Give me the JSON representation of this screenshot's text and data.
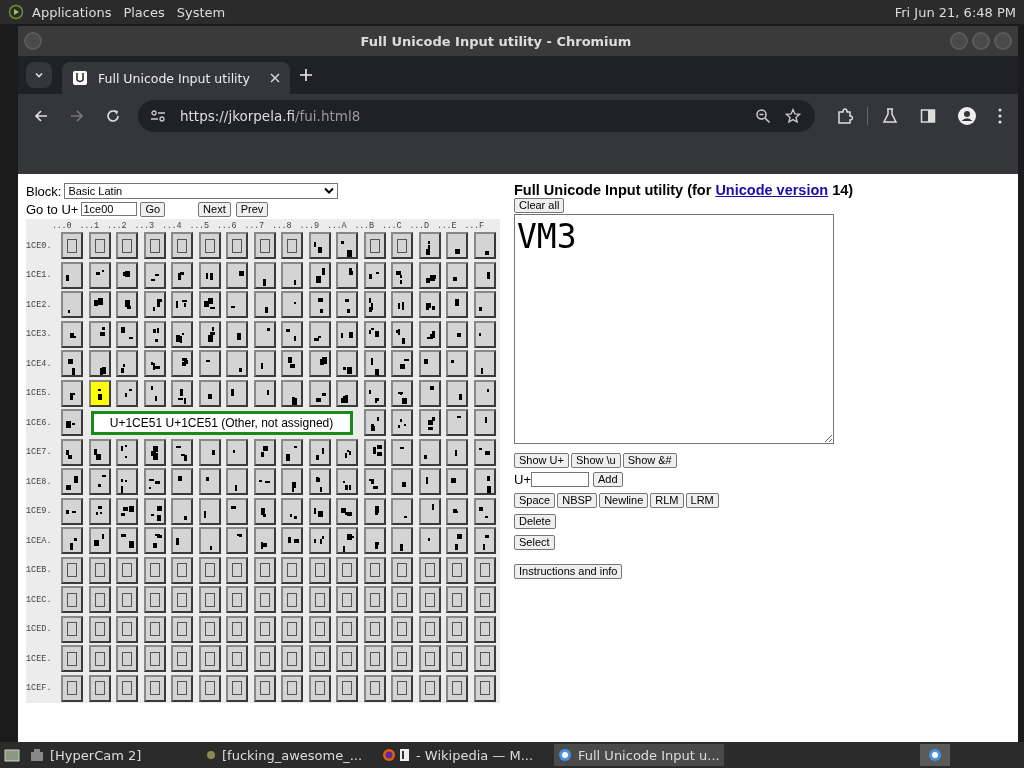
{
  "top_panel": {
    "menus": [
      "Applications",
      "Places",
      "System"
    ],
    "clock": "Fri Jun 21, 6:48 PM"
  },
  "window": {
    "title": "Full Unicode Input utility - Chromium"
  },
  "tabs": [
    {
      "label": "Full Unicode Input utility",
      "selected": true
    }
  ],
  "address_bar": {
    "url_host": "https://jkorpela.fi",
    "url_path": "/fui.html8"
  },
  "page": {
    "block": {
      "label": "Block:",
      "value": "Basic Latin"
    },
    "goto": {
      "label": "Go to U+",
      "value": "1ce00",
      "buttons": [
        "Go",
        "Next",
        "Prev"
      ]
    },
    "column_headers": [
      "...0",
      "...1",
      "...2",
      "...3",
      "...4",
      "...5",
      "...6",
      "...7",
      "...8",
      "...9",
      "...A",
      "...B",
      "...C",
      "...D",
      "...E",
      "...F"
    ],
    "rows": [
      {
        "label": "1CE0.",
        "cells": [
          {
            "kind": "missing",
            "selected": false
          },
          {
            "kind": "missing",
            "selected": false
          },
          {
            "kind": "missing",
            "selected": false
          },
          {
            "kind": "missing",
            "selected": false
          },
          {
            "kind": "missing",
            "selected": false
          },
          {
            "kind": "missing",
            "selected": false
          },
          {
            "kind": "missing",
            "selected": false
          },
          {
            "kind": "missing",
            "selected": false
          },
          {
            "kind": "missing",
            "selected": false
          },
          {
            "kind": "glyph",
            "selected": false
          },
          {
            "kind": "glyph",
            "selected": false
          },
          {
            "kind": "missing",
            "selected": false
          },
          {
            "kind": "missing",
            "selected": false
          },
          {
            "kind": "glyph",
            "selected": false
          },
          {
            "kind": "glyph",
            "selected": false
          },
          {
            "kind": "glyph",
            "selected": false
          }
        ]
      },
      {
        "label": "1CE1.",
        "cells": [
          {
            "kind": "glyph",
            "selected": false
          },
          {
            "kind": "glyph",
            "selected": false
          },
          {
            "kind": "glyph",
            "selected": false
          },
          {
            "kind": "glyph",
            "selected": false
          },
          {
            "kind": "glyph",
            "selected": false
          },
          {
            "kind": "glyph",
            "selected": false
          },
          {
            "kind": "glyph",
            "selected": false
          },
          {
            "kind": "glyph",
            "selected": false
          },
          {
            "kind": "glyph",
            "selected": false
          },
          {
            "kind": "glyph",
            "selected": false
          },
          {
            "kind": "glyph",
            "selected": false
          },
          {
            "kind": "glyph",
            "selected": false
          },
          {
            "kind": "glyph",
            "selected": false
          },
          {
            "kind": "glyph",
            "selected": false
          },
          {
            "kind": "glyph",
            "selected": false
          },
          {
            "kind": "glyph",
            "selected": false
          }
        ]
      },
      {
        "label": "1CE2.",
        "cells": [
          {
            "kind": "glyph",
            "selected": false
          },
          {
            "kind": "glyph",
            "selected": false
          },
          {
            "kind": "glyph",
            "selected": false
          },
          {
            "kind": "glyph",
            "selected": false
          },
          {
            "kind": "glyph",
            "selected": false
          },
          {
            "kind": "glyph",
            "selected": false
          },
          {
            "kind": "glyph",
            "selected": false
          },
          {
            "kind": "glyph",
            "selected": false
          },
          {
            "kind": "glyph",
            "selected": false
          },
          {
            "kind": "glyph",
            "selected": false
          },
          {
            "kind": "glyph",
            "selected": false
          },
          {
            "kind": "glyph",
            "selected": false
          },
          {
            "kind": "glyph",
            "selected": false
          },
          {
            "kind": "glyph",
            "selected": false
          },
          {
            "kind": "glyph",
            "selected": false
          },
          {
            "kind": "glyph",
            "selected": false
          }
        ]
      },
      {
        "label": "1CE3.",
        "cells": [
          {
            "kind": "glyph",
            "selected": false
          },
          {
            "kind": "glyph",
            "selected": false
          },
          {
            "kind": "glyph",
            "selected": false
          },
          {
            "kind": "glyph",
            "selected": false
          },
          {
            "kind": "glyph",
            "selected": false
          },
          {
            "kind": "glyph",
            "selected": false
          },
          {
            "kind": "glyph",
            "selected": false
          },
          {
            "kind": "glyph",
            "selected": false
          },
          {
            "kind": "glyph",
            "selected": false
          },
          {
            "kind": "glyph",
            "selected": false
          },
          {
            "kind": "glyph",
            "selected": false
          },
          {
            "kind": "glyph",
            "selected": false
          },
          {
            "kind": "glyph",
            "selected": false
          },
          {
            "kind": "glyph",
            "selected": false
          },
          {
            "kind": "glyph",
            "selected": false
          },
          {
            "kind": "glyph",
            "selected": false
          }
        ]
      },
      {
        "label": "1CE4.",
        "cells": [
          {
            "kind": "glyph",
            "selected": false
          },
          {
            "kind": "glyph",
            "selected": false
          },
          {
            "kind": "glyph",
            "selected": false
          },
          {
            "kind": "glyph",
            "selected": false
          },
          {
            "kind": "glyph",
            "selected": false
          },
          {
            "kind": "glyph",
            "selected": false
          },
          {
            "kind": "glyph",
            "selected": false
          },
          {
            "kind": "glyph",
            "selected": false
          },
          {
            "kind": "glyph",
            "selected": false
          },
          {
            "kind": "glyph",
            "selected": false
          },
          {
            "kind": "glyph",
            "selected": false
          },
          {
            "kind": "glyph",
            "selected": false
          },
          {
            "kind": "glyph",
            "selected": false
          },
          {
            "kind": "glyph",
            "selected": false
          },
          {
            "kind": "glyph",
            "selected": false
          },
          {
            "kind": "glyph",
            "selected": false
          }
        ]
      },
      {
        "label": "1CE5.",
        "cells": [
          {
            "kind": "glyph",
            "selected": false
          },
          {
            "kind": "glyph",
            "selected": true
          },
          {
            "kind": "glyph",
            "selected": false
          },
          {
            "kind": "glyph",
            "selected": false
          },
          {
            "kind": "glyph",
            "selected": false
          },
          {
            "kind": "glyph",
            "selected": false
          },
          {
            "kind": "glyph",
            "selected": false
          },
          {
            "kind": "glyph",
            "selected": false
          },
          {
            "kind": "glyph",
            "selected": false
          },
          {
            "kind": "glyph",
            "selected": false
          },
          {
            "kind": "glyph",
            "selected": false
          },
          {
            "kind": "glyph",
            "selected": false
          },
          {
            "kind": "glyph",
            "selected": false
          },
          {
            "kind": "glyph",
            "selected": false
          },
          {
            "kind": "glyph",
            "selected": false
          },
          {
            "kind": "glyph",
            "selected": false
          }
        ]
      },
      {
        "label": "1CE6.",
        "cells": [
          {
            "kind": "glyph",
            "selected": false
          },
          {
            "kind": "tooltip",
            "text": "U+1CE51 U+1CE51 (Other, not assigned)"
          },
          {
            "kind": "glyph",
            "selected": false
          },
          {
            "kind": "glyph",
            "selected": false
          },
          {
            "kind": "glyph",
            "selected": false
          },
          {
            "kind": "glyph",
            "selected": false
          },
          {
            "kind": "glyph",
            "selected": false
          }
        ]
      },
      {
        "label": "1CE7.",
        "cells": [
          {
            "kind": "glyph",
            "selected": false
          },
          {
            "kind": "glyph",
            "selected": false
          },
          {
            "kind": "glyph",
            "selected": false
          },
          {
            "kind": "glyph",
            "selected": false
          },
          {
            "kind": "glyph",
            "selected": false
          },
          {
            "kind": "glyph",
            "selected": false
          },
          {
            "kind": "glyph",
            "selected": false
          },
          {
            "kind": "glyph",
            "selected": false
          },
          {
            "kind": "glyph",
            "selected": false
          },
          {
            "kind": "glyph",
            "selected": false
          },
          {
            "kind": "glyph",
            "selected": false
          },
          {
            "kind": "glyph",
            "selected": false
          },
          {
            "kind": "glyph",
            "selected": false
          },
          {
            "kind": "glyph",
            "selected": false
          },
          {
            "kind": "glyph",
            "selected": false
          },
          {
            "kind": "glyph",
            "selected": false
          }
        ]
      },
      {
        "label": "1CE8.",
        "cells": [
          {
            "kind": "glyph",
            "selected": false
          },
          {
            "kind": "glyph",
            "selected": false
          },
          {
            "kind": "glyph",
            "selected": false
          },
          {
            "kind": "glyph",
            "selected": false
          },
          {
            "kind": "glyph",
            "selected": false
          },
          {
            "kind": "glyph",
            "selected": false
          },
          {
            "kind": "glyph",
            "selected": false
          },
          {
            "kind": "glyph",
            "selected": false
          },
          {
            "kind": "glyph",
            "selected": false
          },
          {
            "kind": "glyph",
            "selected": false
          },
          {
            "kind": "glyph",
            "selected": false
          },
          {
            "kind": "glyph",
            "selected": false
          },
          {
            "kind": "glyph",
            "selected": false
          },
          {
            "kind": "glyph",
            "selected": false
          },
          {
            "kind": "glyph",
            "selected": false
          },
          {
            "kind": "glyph",
            "selected": false
          }
        ]
      },
      {
        "label": "1CE9.",
        "cells": [
          {
            "kind": "glyph",
            "selected": false
          },
          {
            "kind": "glyph",
            "selected": false
          },
          {
            "kind": "glyph",
            "selected": false
          },
          {
            "kind": "glyph",
            "selected": false
          },
          {
            "kind": "glyph",
            "selected": false
          },
          {
            "kind": "glyph",
            "selected": false
          },
          {
            "kind": "glyph",
            "selected": false
          },
          {
            "kind": "glyph",
            "selected": false
          },
          {
            "kind": "glyph",
            "selected": false
          },
          {
            "kind": "glyph",
            "selected": false
          },
          {
            "kind": "glyph",
            "selected": false
          },
          {
            "kind": "glyph",
            "selected": false
          },
          {
            "kind": "glyph",
            "selected": false
          },
          {
            "kind": "glyph",
            "selected": false
          },
          {
            "kind": "glyph",
            "selected": false
          },
          {
            "kind": "glyph",
            "selected": false
          }
        ]
      },
      {
        "label": "1CEA.",
        "cells": [
          {
            "kind": "glyph",
            "selected": false
          },
          {
            "kind": "glyph",
            "selected": false
          },
          {
            "kind": "glyph",
            "selected": false
          },
          {
            "kind": "glyph",
            "selected": false
          },
          {
            "kind": "glyph",
            "selected": false
          },
          {
            "kind": "glyph",
            "selected": false
          },
          {
            "kind": "glyph",
            "selected": false
          },
          {
            "kind": "glyph",
            "selected": false
          },
          {
            "kind": "glyph",
            "selected": false
          },
          {
            "kind": "glyph",
            "selected": false
          },
          {
            "kind": "glyph",
            "selected": false
          },
          {
            "kind": "glyph",
            "selected": false
          },
          {
            "kind": "glyph",
            "selected": false
          },
          {
            "kind": "glyph",
            "selected": false
          },
          {
            "kind": "glyph",
            "selected": false
          },
          {
            "kind": "glyph",
            "selected": false
          }
        ]
      },
      {
        "label": "1CEB.",
        "cells": [
          {
            "kind": "missing",
            "selected": false
          },
          {
            "kind": "missing",
            "selected": false
          },
          {
            "kind": "missing",
            "selected": false
          },
          {
            "kind": "missing",
            "selected": false
          },
          {
            "kind": "missing",
            "selected": false
          },
          {
            "kind": "missing",
            "selected": false
          },
          {
            "kind": "missing",
            "selected": false
          },
          {
            "kind": "missing",
            "selected": false
          },
          {
            "kind": "missing",
            "selected": false
          },
          {
            "kind": "missing",
            "selected": false
          },
          {
            "kind": "missing",
            "selected": false
          },
          {
            "kind": "missing",
            "selected": false
          },
          {
            "kind": "missing",
            "selected": false
          },
          {
            "kind": "missing",
            "selected": false
          },
          {
            "kind": "missing",
            "selected": false
          },
          {
            "kind": "missing",
            "selected": false
          }
        ]
      },
      {
        "label": "1CEC.",
        "cells": [
          {
            "kind": "missing",
            "selected": false
          },
          {
            "kind": "missing",
            "selected": false
          },
          {
            "kind": "missing",
            "selected": false
          },
          {
            "kind": "missing",
            "selected": false
          },
          {
            "kind": "missing",
            "selected": false
          },
          {
            "kind": "missing",
            "selected": false
          },
          {
            "kind": "missing",
            "selected": false
          },
          {
            "kind": "missing",
            "selected": false
          },
          {
            "kind": "missing",
            "selected": false
          },
          {
            "kind": "missing",
            "selected": false
          },
          {
            "kind": "missing",
            "selected": false
          },
          {
            "kind": "missing",
            "selected": false
          },
          {
            "kind": "missing",
            "selected": false
          },
          {
            "kind": "missing",
            "selected": false
          },
          {
            "kind": "missing",
            "selected": false
          },
          {
            "kind": "missing",
            "selected": false
          }
        ]
      },
      {
        "label": "1CED.",
        "cells": [
          {
            "kind": "missing",
            "selected": false
          },
          {
            "kind": "missing",
            "selected": false
          },
          {
            "kind": "missing",
            "selected": false
          },
          {
            "kind": "missing",
            "selected": false
          },
          {
            "kind": "missing",
            "selected": false
          },
          {
            "kind": "missing",
            "selected": false
          },
          {
            "kind": "missing",
            "selected": false
          },
          {
            "kind": "missing",
            "selected": false
          },
          {
            "kind": "missing",
            "selected": false
          },
          {
            "kind": "missing",
            "selected": false
          },
          {
            "kind": "missing",
            "selected": false
          },
          {
            "kind": "missing",
            "selected": false
          },
          {
            "kind": "missing",
            "selected": false
          },
          {
            "kind": "missing",
            "selected": false
          },
          {
            "kind": "missing",
            "selected": false
          },
          {
            "kind": "missing",
            "selected": false
          }
        ]
      },
      {
        "label": "1CEE.",
        "cells": [
          {
            "kind": "missing",
            "selected": false
          },
          {
            "kind": "missing",
            "selected": false
          },
          {
            "kind": "missing",
            "selected": false
          },
          {
            "kind": "missing",
            "selected": false
          },
          {
            "kind": "missing",
            "selected": false
          },
          {
            "kind": "missing",
            "selected": false
          },
          {
            "kind": "missing",
            "selected": false
          },
          {
            "kind": "missing",
            "selected": false
          },
          {
            "kind": "missing",
            "selected": false
          },
          {
            "kind": "missing",
            "selected": false
          },
          {
            "kind": "missing",
            "selected": false
          },
          {
            "kind": "missing",
            "selected": false
          },
          {
            "kind": "missing",
            "selected": false
          },
          {
            "kind": "missing",
            "selected": false
          },
          {
            "kind": "missing",
            "selected": false
          },
          {
            "kind": "missing",
            "selected": false
          }
        ]
      },
      {
        "label": "1CEF.",
        "cells": [
          {
            "kind": "missing",
            "selected": false
          },
          {
            "kind": "missing",
            "selected": false
          },
          {
            "kind": "missing",
            "selected": false
          },
          {
            "kind": "missing",
            "selected": false
          },
          {
            "kind": "missing",
            "selected": false
          },
          {
            "kind": "missing",
            "selected": false
          },
          {
            "kind": "missing",
            "selected": false
          },
          {
            "kind": "missing",
            "selected": false
          },
          {
            "kind": "missing",
            "selected": false
          },
          {
            "kind": "missing",
            "selected": false
          },
          {
            "kind": "missing",
            "selected": false
          },
          {
            "kind": "missing",
            "selected": false
          },
          {
            "kind": "missing",
            "selected": false
          },
          {
            "kind": "missing",
            "selected": false
          },
          {
            "kind": "missing",
            "selected": false
          },
          {
            "kind": "missing",
            "selected": false
          }
        ]
      }
    ],
    "heading": {
      "before": "Full Unicode Input utility (for ",
      "link": "Unicode version",
      "after": " 14)"
    },
    "clear_button": "Clear all",
    "text_area": {
      "value": "VM3"
    },
    "show_buttons": [
      "Show U+",
      "Show \\u",
      "Show &#"
    ],
    "add": {
      "label": "U+",
      "button": "Add"
    },
    "insert_buttons": [
      "Space",
      "NBSP",
      "Newline",
      "RLM",
      "LRM"
    ],
    "delete_button": "Delete",
    "select_button": "Select",
    "info_button": "Instructions and info"
  },
  "taskbar": [
    {
      "label": "[HyperCam 2]",
      "selected": false
    },
    {
      "label": "[fucking_awesome_...",
      "selected": false
    },
    {
      "label": "- Wikipedia — M...",
      "selected": false
    },
    {
      "label": "Full Unicode Input u...",
      "selected": true
    }
  ]
}
